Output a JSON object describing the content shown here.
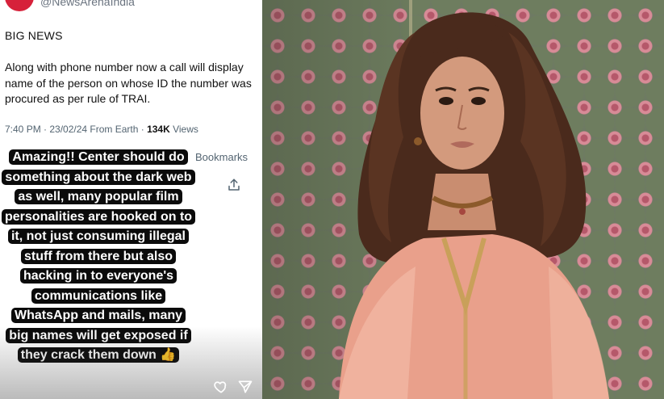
{
  "post": {
    "handle": "@NewsArenaIndia",
    "heading": "BIG NEWS",
    "body": "Along with phone number now a call will display name of the person on whose ID the number was procured as per rule of TRAI.",
    "time_place": "7:40 PM · 23/02/24 From Earth · ",
    "views_count": "134K",
    "views_label": " Views",
    "bookmarks_label": "Bookmarks",
    "share_icon": "share-icon"
  },
  "story": {
    "caption": "Amazing!! Center should do something about the dark web as well, many popular film personalities are hooked on to it, not just consuming illegal stuff from there but also hacking in to everyone's communications like WhatsApp and mails, many big names will get exposed if they crack them down 👍",
    "like_icon": "heart-icon",
    "send_icon": "send-icon"
  },
  "colors": {
    "avatar": "#d6213a",
    "caption_bg": "#0b0b0b",
    "meta_text": "#536471",
    "dress": "#e9a08b",
    "wallpaper": "#6e7a63"
  }
}
